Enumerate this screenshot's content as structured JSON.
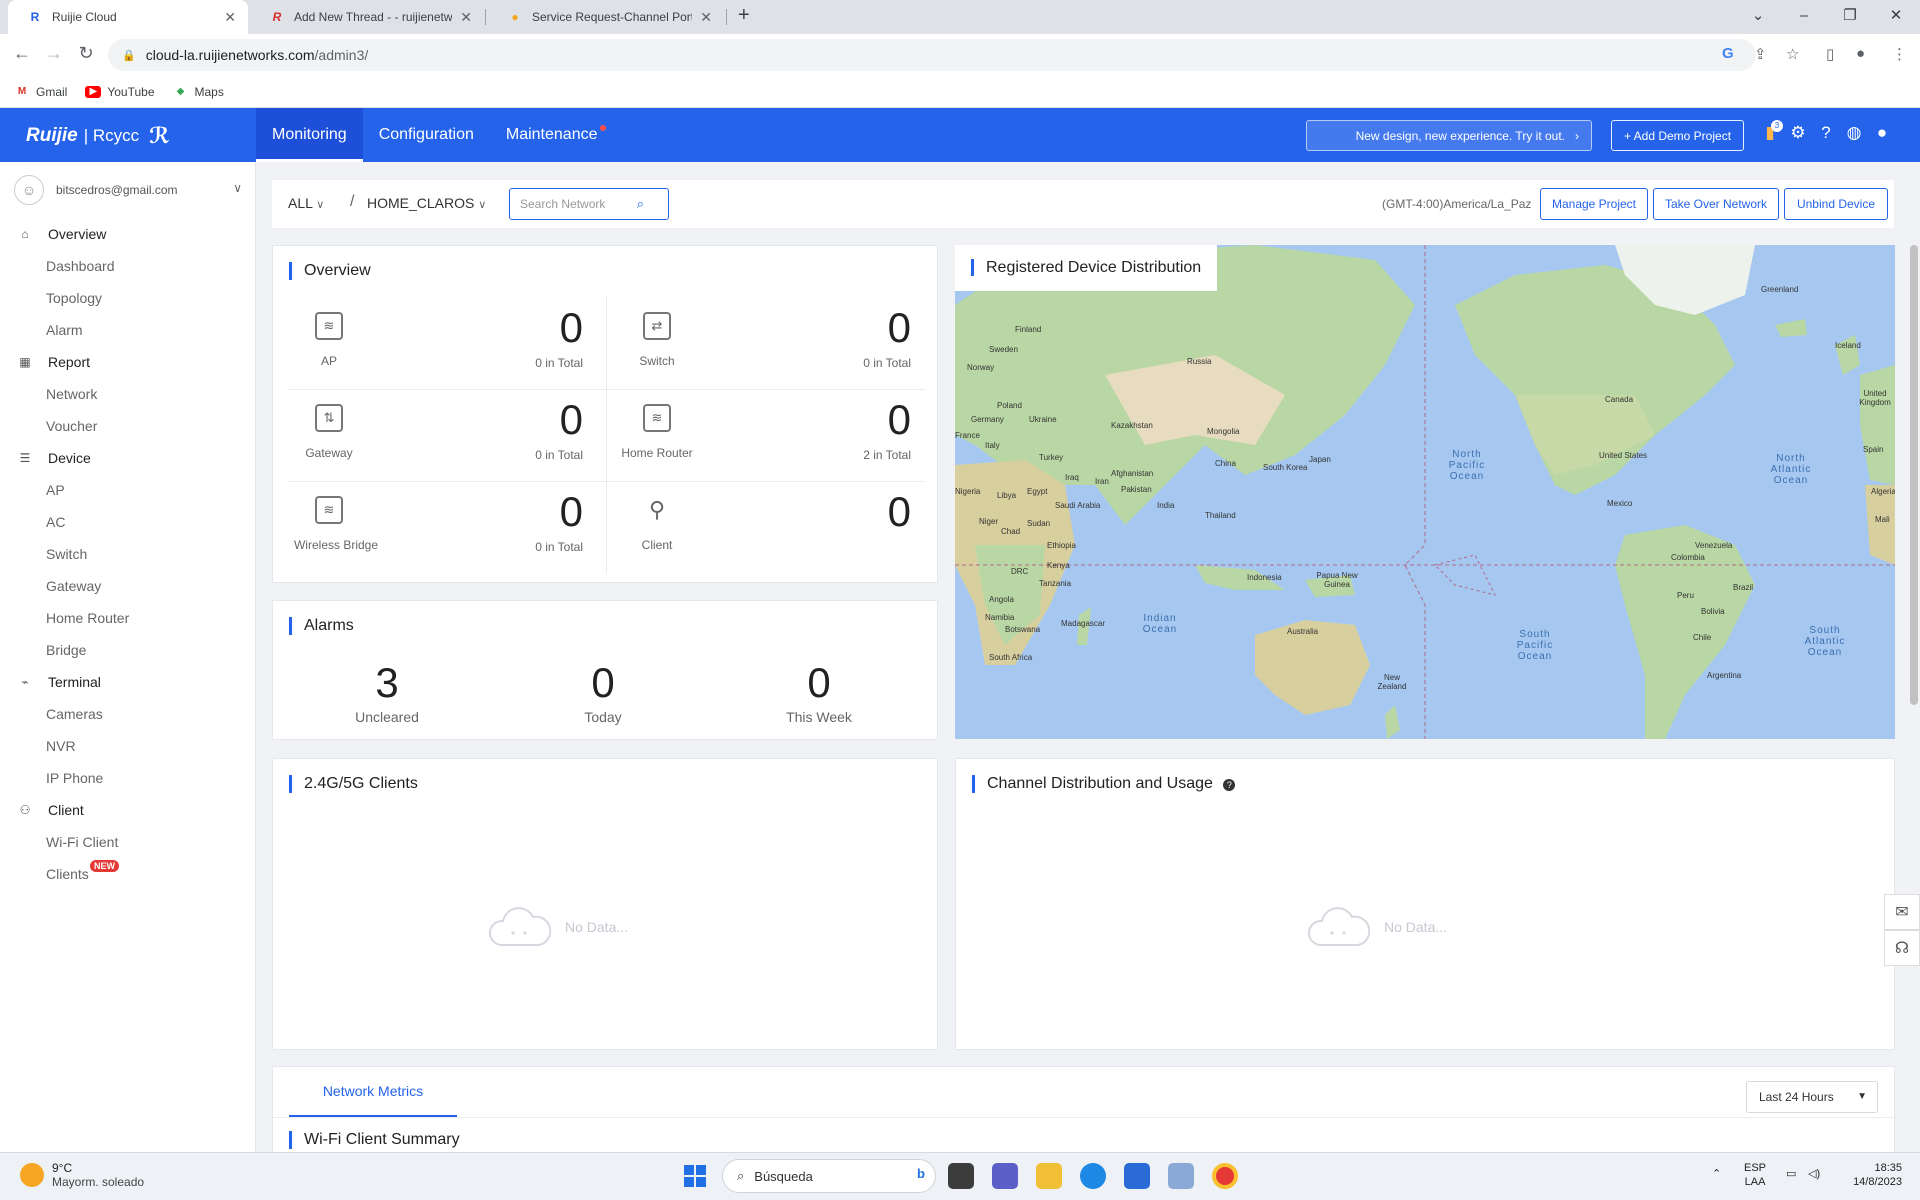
{
  "browser": {
    "tabs": [
      {
        "title": "Ruijie Cloud",
        "active": true
      },
      {
        "title": "Add New Thread - - ruijienetwor",
        "active": false
      },
      {
        "title": "Service Request-Channel Portal",
        "active": false
      }
    ],
    "new_tab": "+",
    "url_host": "cloud-la.ruijienetworks.com",
    "url_path": "/admin3/",
    "bookmarks": [
      "Gmail",
      "YouTube",
      "Maps"
    ]
  },
  "header": {
    "logo": "Ruijie",
    "logo_sub": "| Rcycc",
    "nav": [
      {
        "label": "Monitoring",
        "active": true
      },
      {
        "label": "Configuration",
        "active": false
      },
      {
        "label": "Maintenance",
        "active": false
      }
    ],
    "promo": "New design, new experience. Try it out.",
    "add_demo": "+ Add Demo Project",
    "notification_count": "3",
    "colors": {
      "primary": "#2563eb",
      "alert": "#ff4d4f"
    }
  },
  "sidebar": {
    "account": "bitscedros@gmail.com",
    "groups": [
      {
        "label": "Overview",
        "icon": "home-icon",
        "items": [
          "Dashboard",
          "Topology",
          "Alarm"
        ]
      },
      {
        "label": "Report",
        "icon": "chart-icon",
        "items": [
          "Network",
          "Voucher"
        ]
      },
      {
        "label": "Device",
        "icon": "list-icon",
        "items": [
          "AP",
          "AC",
          "Switch",
          "Gateway",
          "Home Router",
          "Bridge"
        ]
      },
      {
        "label": "Terminal",
        "icon": "terminal-icon",
        "items": [
          "Cameras",
          "NVR",
          "IP Phone"
        ]
      },
      {
        "label": "Client",
        "icon": "users-icon",
        "items": [
          "Wi-Fi Client",
          "Clients"
        ]
      }
    ],
    "new_badge": "NEW"
  },
  "toolbar": {
    "scope": "ALL",
    "network": "HOME_CLAROS",
    "search_placeholder": "Search Network",
    "timezone": "(GMT-4:00)America/La_Paz",
    "buttons": [
      "Manage Project",
      "Take Over Network",
      "Unbind Device"
    ]
  },
  "overview": {
    "title": "Overview",
    "cells": [
      {
        "label": "AP",
        "value": "0",
        "sub": "0 in Total",
        "icon": "ap-icon"
      },
      {
        "label": "Switch",
        "value": "0",
        "sub": "0 in Total",
        "icon": "switch-icon"
      },
      {
        "label": "Gateway",
        "value": "0",
        "sub": "0 in Total",
        "icon": "gateway-icon"
      },
      {
        "label": "Home Router",
        "value": "0",
        "sub": "2 in Total",
        "icon": "router-icon"
      },
      {
        "label": "Wireless Bridge",
        "value": "0",
        "sub": "0 in Total",
        "icon": "bridge-icon"
      },
      {
        "label": "Client",
        "value": "0",
        "sub": "",
        "icon": "client-icon"
      }
    ]
  },
  "alarms": {
    "title": "Alarms",
    "items": [
      {
        "value": "3",
        "label": "Uncleared"
      },
      {
        "value": "0",
        "label": "Today"
      },
      {
        "value": "0",
        "label": "This Week"
      }
    ]
  },
  "map": {
    "title": "Registered Device Distribution",
    "labels": [
      "Finland",
      "Sweden",
      "Norway",
      "Poland",
      "Germany",
      "France",
      "Ukraine",
      "Italy",
      "Russia",
      "Kazakhstan",
      "Mongolia",
      "Turkey",
      "Iraq",
      "Iran",
      "Afghanistan",
      "Pakistan",
      "China",
      "South Korea",
      "Japan",
      "India",
      "Thailand",
      "Saudi Arabia",
      "Egypt",
      "Libya",
      "Nigeria",
      "Niger",
      "Chad",
      "Sudan",
      "Ethiopia",
      "Kenya",
      "DRC",
      "Tanzania",
      "Angola",
      "Namibia",
      "Botswana",
      "Madagascar",
      "South Africa",
      "Indonesia",
      "Papua New Guinea",
      "Australia",
      "New Zealand",
      "Greenland",
      "Iceland",
      "Canada",
      "United States",
      "Mexico",
      "Venezuela",
      "Colombia",
      "Peru",
      "Brazil",
      "Bolivia",
      "Chile",
      "Argentina",
      "United Kingdom",
      "Spain",
      "Algeria",
      "Mali"
    ],
    "oceans": [
      "North Pacific Ocean",
      "North Atlantic Ocean",
      "Indian Ocean",
      "South Pacific Ocean",
      "South Atlantic Ocean"
    ]
  },
  "clients_card": {
    "title": "2.4G/5G Clients",
    "empty": "No Data..."
  },
  "channel_card": {
    "title": "Channel Distribution and Usage",
    "empty": "No Data..."
  },
  "metrics": {
    "tab": "Network Metrics",
    "range": "Last 24 Hours",
    "section": "Wi-Fi Client Summary"
  },
  "taskbar": {
    "temp": "9°C",
    "weather": "Mayorm. soleado",
    "search": "Búsqueda",
    "lang": "ESP",
    "layout": "LAA",
    "time": "18:35",
    "date": "14/8/2023"
  }
}
